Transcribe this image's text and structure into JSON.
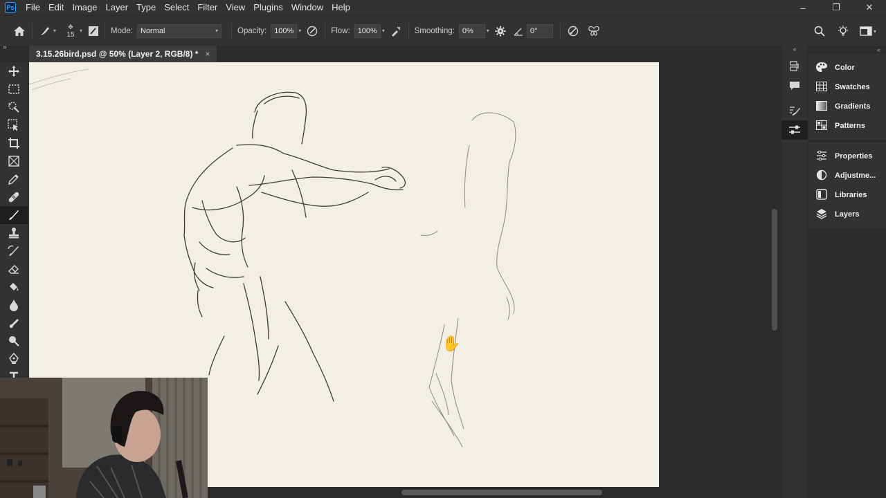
{
  "app": {
    "logo": "Ps"
  },
  "menu": [
    "File",
    "Edit",
    "Image",
    "Layer",
    "Type",
    "Select",
    "Filter",
    "View",
    "Plugins",
    "Window",
    "Help"
  ],
  "window_controls": {
    "minimize": "–",
    "restore": "❐",
    "close": "✕"
  },
  "options": {
    "brush_size": "15",
    "mode_label": "Mode:",
    "mode_value": "Normal",
    "opacity_label": "Opacity:",
    "opacity_value": "100%",
    "flow_label": "Flow:",
    "flow_value": "100%",
    "smoothing_label": "Smoothing:",
    "smoothing_value": "0%",
    "angle_value": "0°"
  },
  "document_tab": {
    "title": "3.15.26bird.psd @ 50% (Layer 2, RGB/8) *",
    "close": "×"
  },
  "tools": [
    "move-tool",
    "marquee-tool",
    "object-select-tool",
    "frame-tool",
    "crop-tool",
    "frame-x-tool",
    "eyedropper-tool",
    "healing-tool",
    "brush-tool",
    "stamp-tool",
    "history-brush-tool",
    "eraser-tool",
    "paint-bucket-tool",
    "blur-tool",
    "smudge-tool",
    "dodge-tool",
    "pen-tool",
    "type-tool"
  ],
  "active_tool": "brush-tool",
  "panels": {
    "group1": [
      "Color",
      "Swatches",
      "Gradients",
      "Patterns"
    ],
    "group2": [
      "Properties",
      "Adjustme...",
      "Libraries",
      "Layers"
    ]
  },
  "colors": {
    "accent": "#31a8ff",
    "canvas": "#f2efe5",
    "ui_dark": "#323232"
  }
}
